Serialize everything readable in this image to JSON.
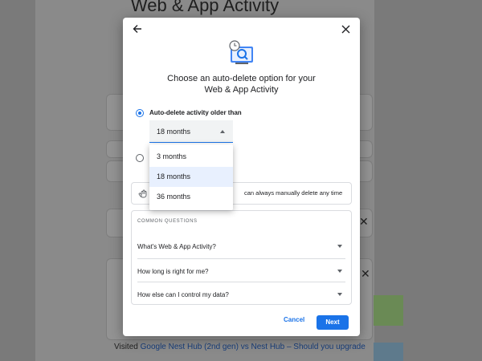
{
  "background_page": {
    "title": "Web & App Activity",
    "visited_prefix": "Visited",
    "visited_link": "Google Nest Hub (2nd gen) vs Nest Hub – Should you upgrade"
  },
  "dialog": {
    "heading_line1": "Choose an auto-delete option for your",
    "heading_line2": "Web & App Activity",
    "option1_label": "Auto-delete activity older than",
    "select_value": "18 months",
    "menu_options": [
      "3 months",
      "18 months",
      "36 months"
    ],
    "selected_option": "18 months",
    "info_text": "can always manually delete any time",
    "faq_heading": "COMMON QUESTIONS",
    "faq_items": [
      "What's Web & App Activity?",
      "How long is right for me?",
      "How else can I control my data?"
    ],
    "cancel_label": "Cancel",
    "next_label": "Next"
  },
  "colors": {
    "accent": "#1a73e8",
    "selected_bg": "#e8f0fe",
    "overlay": "#8a8a8a"
  },
  "icons": {
    "back": "arrow-back-icon",
    "close": "close-icon",
    "hero": "clock-search-icon",
    "hand": "hand-icon",
    "expand": "caret-down-icon"
  }
}
